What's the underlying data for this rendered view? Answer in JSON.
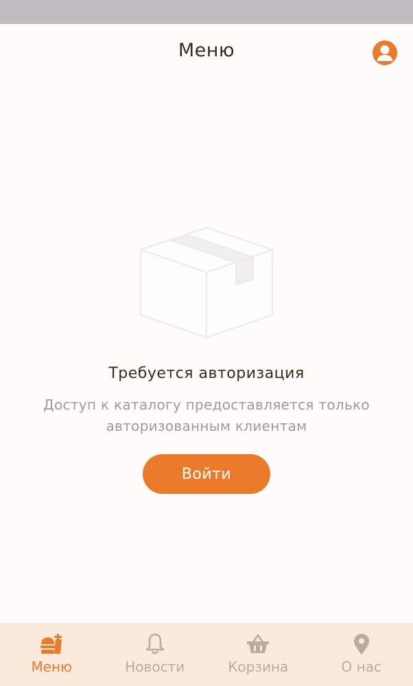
{
  "header": {
    "title": "Меню",
    "profile_icon": "account-circle-icon"
  },
  "empty_state": {
    "illustration_icon": "package-box-icon",
    "title": "Требуется авторизация",
    "description": "Доступ к каталогу предоставляется только авторизованным клиентам",
    "button_label": "Войти"
  },
  "tab_bar": {
    "items": [
      {
        "label": "Меню",
        "icon": "food-icon",
        "active": true
      },
      {
        "label": "Новости",
        "icon": "bell-icon",
        "active": false
      },
      {
        "label": "Корзина",
        "icon": "basket-icon",
        "active": false
      },
      {
        "label": "О нас",
        "icon": "map-pin-icon",
        "active": false
      }
    ]
  },
  "colors": {
    "accent": "#ec7a2b",
    "tab_bar_bg": "#faeadb",
    "inactive_tab": "#b8ac9c",
    "status_bar": "#bfbdc2"
  }
}
